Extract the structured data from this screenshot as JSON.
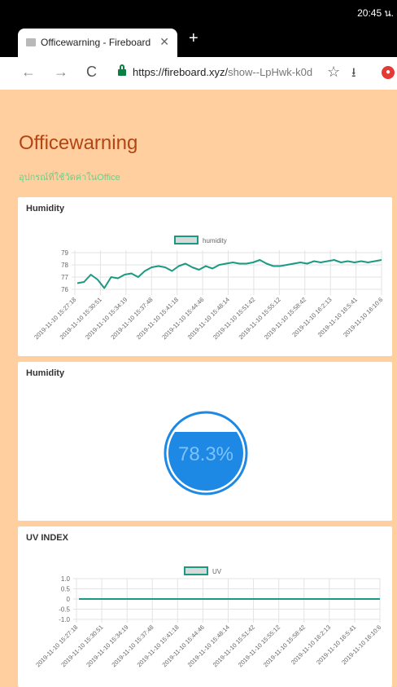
{
  "status_bar": {
    "time": "20:45 น."
  },
  "browser": {
    "tab_title": "Officewarning - Fireboard",
    "url_host": "https://fireboard.xyz/",
    "url_path": "show--LpHwk-k0d"
  },
  "page": {
    "title": "Officewarning",
    "subtitle": "อุปกรณ์ที่ใช้วัดค่าในOffice"
  },
  "colors": {
    "page_bg": "#ffcfa0",
    "title": "#b44512",
    "line": "#1a9a82",
    "gauge": "#1e88e5"
  },
  "cards": {
    "humidity_chart": {
      "title": "Humidity"
    },
    "humidity_gauge": {
      "title": "Humidity",
      "value_text": "78.3%"
    },
    "uv_chart": {
      "title": "UV INDEX"
    }
  },
  "chart_data": [
    {
      "type": "line",
      "title": "Humidity",
      "series": [
        {
          "name": "humidity",
          "values": [
            76.5,
            76.6,
            77.2,
            76.8,
            76.1,
            77.0,
            76.9,
            77.2,
            77.3,
            77.0,
            77.5,
            77.8,
            77.9,
            77.8,
            77.5,
            77.9,
            78.1,
            77.8,
            77.6,
            77.9,
            77.7,
            78.0,
            78.1,
            78.2,
            78.1,
            78.1,
            78.2,
            78.4,
            78.1,
            77.9,
            77.9,
            78.0,
            78.1,
            78.2,
            78.1,
            78.3,
            78.2,
            78.3,
            78.4,
            78.2,
            78.3,
            78.2,
            78.3,
            78.2,
            78.3,
            78.4
          ]
        }
      ],
      "x_tick_labels": [
        "2019-11-10 15:27:18",
        "2019-11-10 15:30:51",
        "2019-11-10 15:34:19",
        "2019-11-10 15:37:48",
        "2019-11-10 15:41:18",
        "2019-11-10 15:44:46",
        "2019-11-10 15:48:14",
        "2019-11-10 15:51:42",
        "2019-11-10 15:55:12",
        "2019-11-10 15:58:42",
        "2019-11-10 16:2:13",
        "2019-11-10 16:5:41",
        "2019-11-10 16:10:6"
      ],
      "y_ticks": [
        76,
        77,
        78,
        79
      ],
      "ylim": [
        75.8,
        79.2
      ],
      "legend": "top-center",
      "grid": true
    },
    {
      "type": "line",
      "title": "UV INDEX",
      "series": [
        {
          "name": "UV",
          "values": [
            0,
            0,
            0,
            0,
            0,
            0,
            0,
            0,
            0,
            0,
            0,
            0,
            0
          ]
        }
      ],
      "x_tick_labels": [
        "2019-11-10 15:27:18",
        "2019-11-10 15:30:51",
        "2019-11-10 15:34:19",
        "2019-11-10 15:37:48",
        "2019-11-10 15:41:18",
        "2019-11-10 15:44:46",
        "2019-11-10 15:48:14",
        "2019-11-10 15:51:42",
        "2019-11-10 15:55:12",
        "2019-11-10 15:58:42",
        "2019-11-10 16:2:13",
        "2019-11-10 16:5:41",
        "2019-11-10 16:10:6"
      ],
      "y_ticks": [
        "1.0",
        "0.5",
        "0",
        "-0.5",
        "-1.0"
      ],
      "ylim": [
        -1.0,
        1.0
      ],
      "legend": "top-center",
      "grid": true
    },
    {
      "type": "gauge",
      "title": "Humidity",
      "value": 78.3,
      "unit": "%"
    }
  ]
}
